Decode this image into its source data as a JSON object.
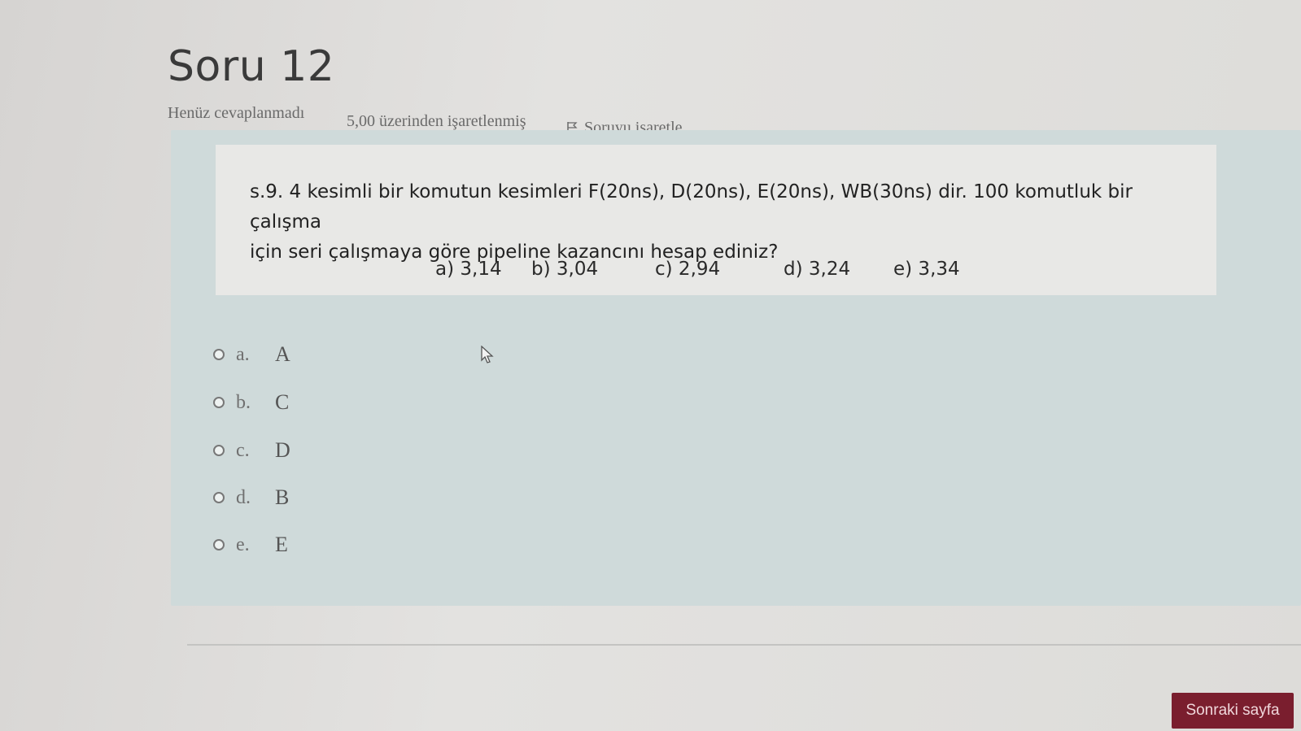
{
  "question": {
    "title": "Soru 12",
    "status": "Henüz cevaplanmadı",
    "mark_info": "5,00 üzerinden işaretlenmiş",
    "flag_label": "Soruyu işaretle",
    "text_line1": "s.9. 4 kesimli bir komutun kesimleri F(20ns), D(20ns), E(20ns), WB(30ns) dir. 100 komutluk bir çalışma",
    "text_line2": "için seri çalışmaya göre pipeline kazancını hesap ediniz?",
    "inline_choices": [
      "a) 3,14",
      "b) 3,04",
      "c) 2,94",
      "d) 3,24",
      "e) 3,34"
    ]
  },
  "answers": [
    {
      "letter": "a.",
      "value": "A"
    },
    {
      "letter": "b.",
      "value": "C"
    },
    {
      "letter": "c.",
      "value": "D"
    },
    {
      "letter": "d.",
      "value": "B"
    },
    {
      "letter": "e.",
      "value": "E"
    }
  ],
  "navigation": {
    "next_label": "Sonraki sayfa"
  },
  "colors": {
    "panel": "#cfdada",
    "next_button": "#7a1e2e"
  }
}
